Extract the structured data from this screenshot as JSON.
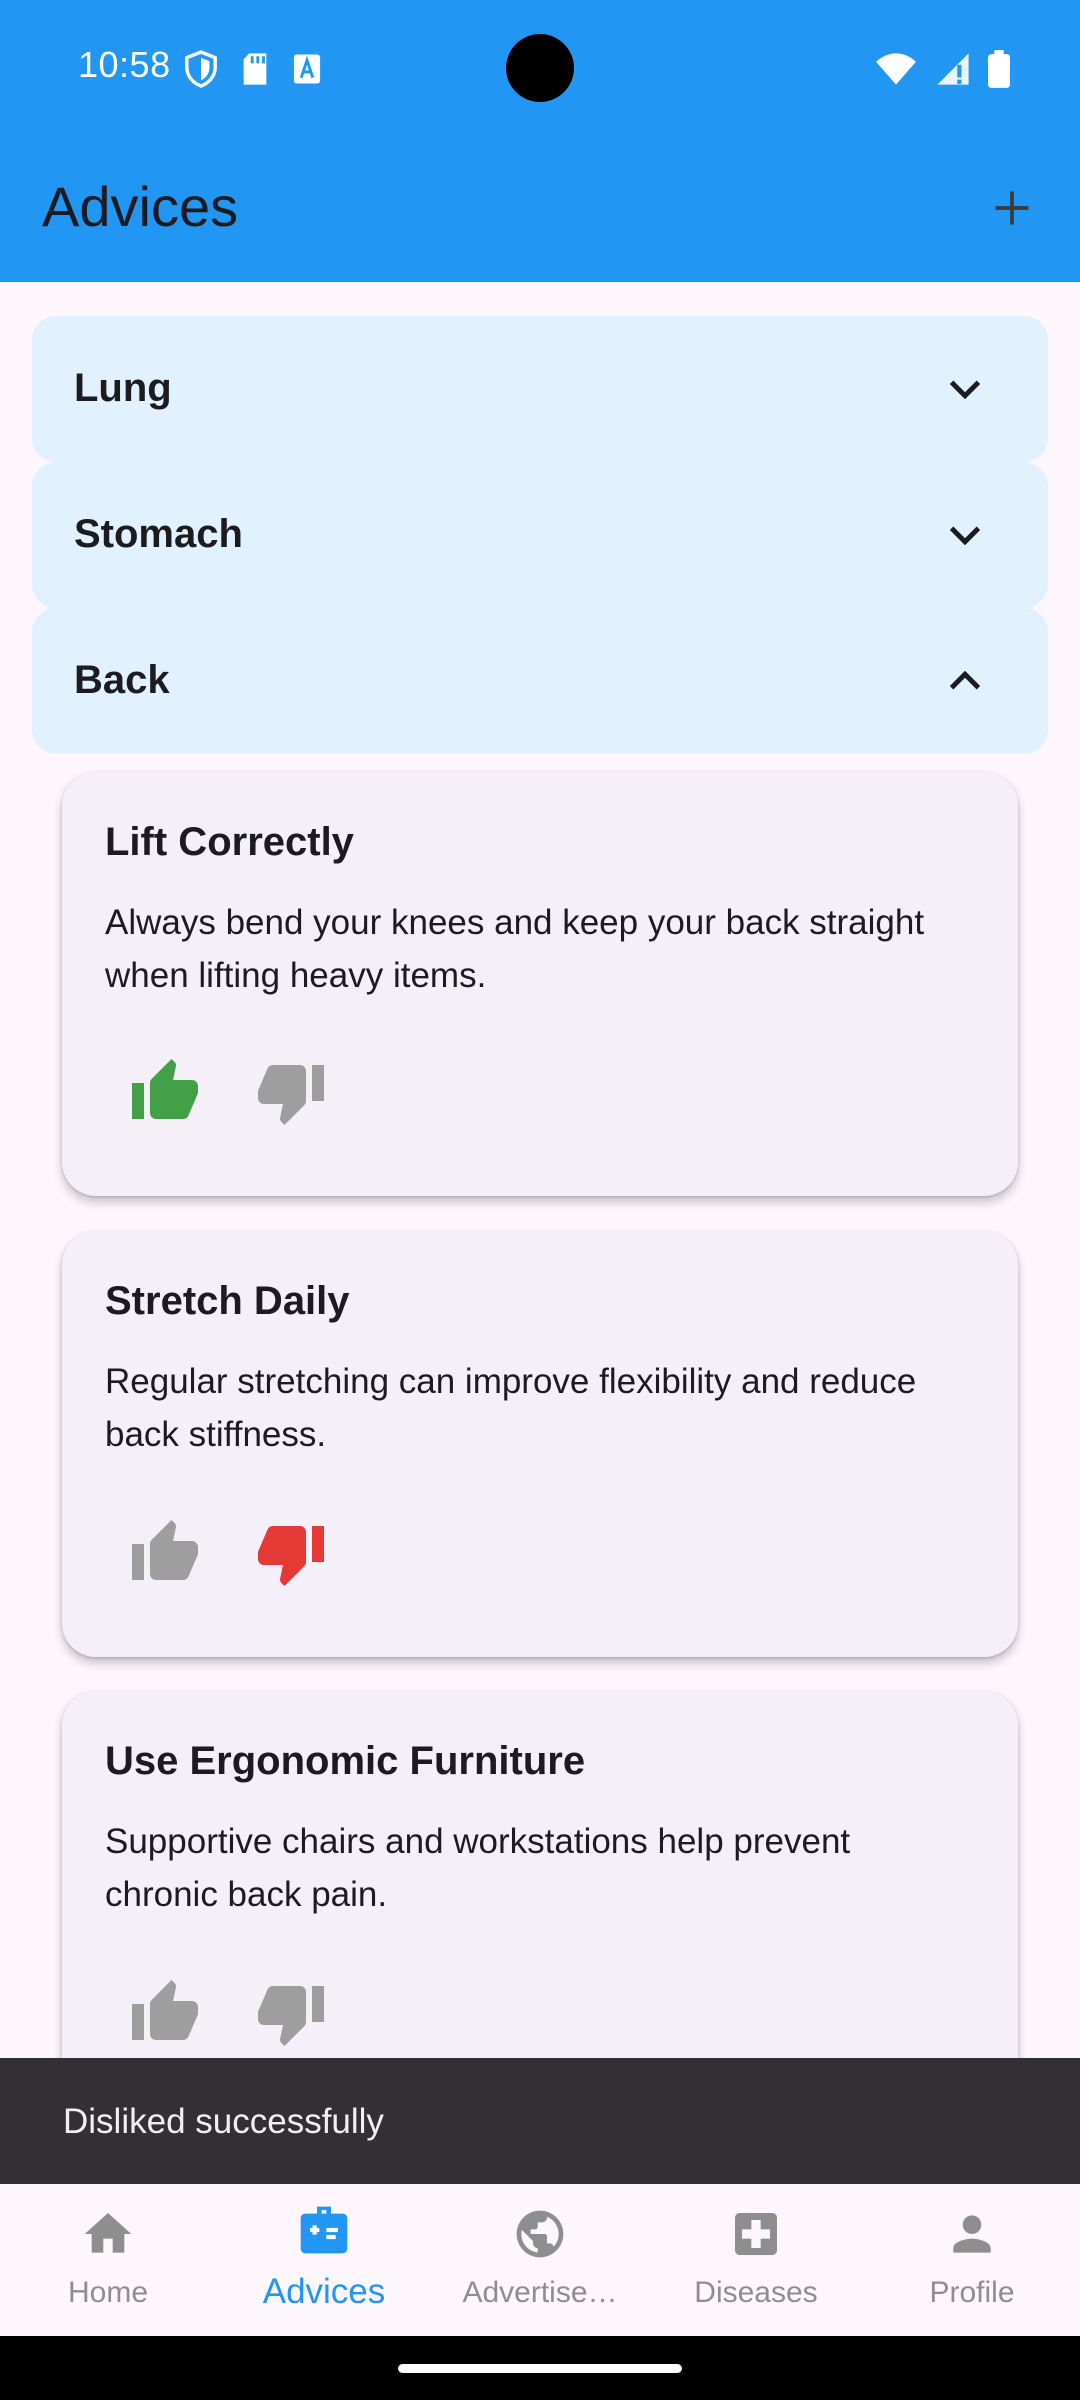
{
  "status_bar": {
    "time": "10:58",
    "left_icons": [
      "shield-icon",
      "sd-card-icon",
      "keyboard-a-icon"
    ],
    "right_icons": [
      "wifi-alert-icon",
      "signal-alert-icon",
      "battery-icon"
    ]
  },
  "app_bar": {
    "title": "Advices",
    "action_icon": "add-icon",
    "background": "#2196f3"
  },
  "categories": [
    {
      "label": "Lung",
      "expanded": false
    },
    {
      "label": "Stomach",
      "expanded": false
    },
    {
      "label": "Back",
      "expanded": true
    }
  ],
  "advices": [
    {
      "title": "Lift Correctly",
      "body": "Always bend your knees and keep your back straight when lifting heavy items.",
      "liked": true,
      "disliked": false
    },
    {
      "title": "Stretch Daily",
      "body": "Regular stretching can improve flexibility and reduce back stiffness.",
      "liked": false,
      "disliked": true
    },
    {
      "title": "Use Ergonomic Furniture",
      "body": "Supportive chairs and workstations help prevent chronic back pain.",
      "liked": false,
      "disliked": false
    }
  ],
  "colors": {
    "like_active": "#43a047",
    "dislike_active": "#e53935",
    "inactive": "#9e9e9e",
    "nav_active": "#2196f3"
  },
  "snackbar": {
    "message": "Disliked successfully"
  },
  "bottom_nav": {
    "items": [
      {
        "label": "Home",
        "icon": "home-icon",
        "active": false
      },
      {
        "label": "Advices",
        "icon": "medical-kit-icon",
        "active": true
      },
      {
        "label": "Advertise…",
        "icon": "globe-icon",
        "active": false
      },
      {
        "label": "Diseases",
        "icon": "medical-cross-icon",
        "active": false
      },
      {
        "label": "Profile",
        "icon": "person-icon",
        "active": false
      }
    ]
  }
}
